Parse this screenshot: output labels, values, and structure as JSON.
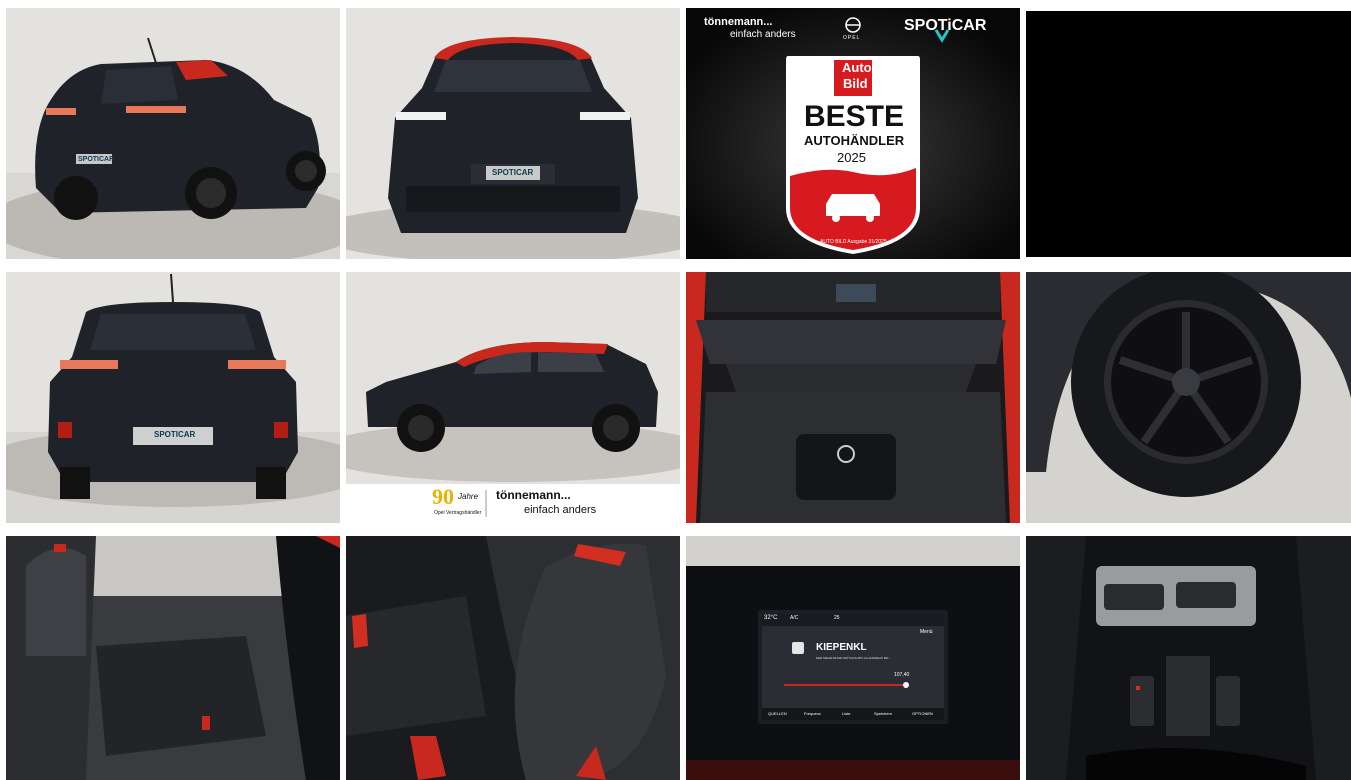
{
  "gallery": {
    "tiles": [
      {
        "id": "rear-three-quarter",
        "subject": "Black Opel Mokka with red roof, rear three-quarter view in showroom",
        "plate_text": "SPOTICAR"
      },
      {
        "id": "front",
        "subject": "Front view of black Opel Mokka with red roof",
        "plate_text": "SPOTICAR"
      },
      {
        "id": "award",
        "subject": "Auto Bild Beste Autohändler 2025 award badge",
        "dealer_name": "tönnemann...",
        "dealer_slogan": "einfach anders",
        "brand_name": "OPEL",
        "brand_logo": "SPOTiCAR",
        "magazine_line1": "Auto",
        "magazine_line2": "Bild",
        "award_title": "BESTE",
        "award_subtitle": "AUTOHÄNDLER",
        "award_year": "2025",
        "award_source": "AUTO BILD Ausgabe 31/2025"
      },
      {
        "id": "blank",
        "subject": "Empty black image placeholder"
      },
      {
        "id": "rear",
        "subject": "Rear view of black Opel Mokka",
        "plate_text": "SPOTICAR"
      },
      {
        "id": "side",
        "subject": "Side profile of black Opel Mokka with red roof",
        "banner_years": "90",
        "banner_years_word": "Jahre",
        "banner_partner": "Opel Vertragshändler",
        "banner_dealer_name": "tönnemann...",
        "banner_dealer_slogan": "einfach anders"
      },
      {
        "id": "trunk",
        "subject": "Open trunk with Opel charging cable bag"
      },
      {
        "id": "wheel",
        "subject": "Black alloy wheel close-up"
      },
      {
        "id": "rear-seats",
        "subject": "Rear seat interior with red accents"
      },
      {
        "id": "front-seat",
        "subject": "Front sport seat with red stripe"
      },
      {
        "id": "infotainment",
        "subject": "Infotainment touchscreen showing radio",
        "temp": "32°C",
        "ac": "A/C",
        "fan": "25",
        "station": "KIEPENKL",
        "station_info": "DER MEHR-MUSIK-MITTAGS-MIX mit ANDREAS MR...",
        "frequency": "107,40",
        "menu": "Menü",
        "tabs": [
          "QUELLEN",
          "Frequenz",
          "Liste",
          "Speichern",
          "OPTIONEN"
        ]
      },
      {
        "id": "center-console",
        "subject": "Center console with gear selector buttons"
      }
    ]
  },
  "colors": {
    "roof_red": "#c8281e",
    "car_black": "#1e2127",
    "showroom_gray": "#d8d6d2",
    "award_red": "#d71920",
    "spoticar_teal": "#1ec8c8"
  }
}
